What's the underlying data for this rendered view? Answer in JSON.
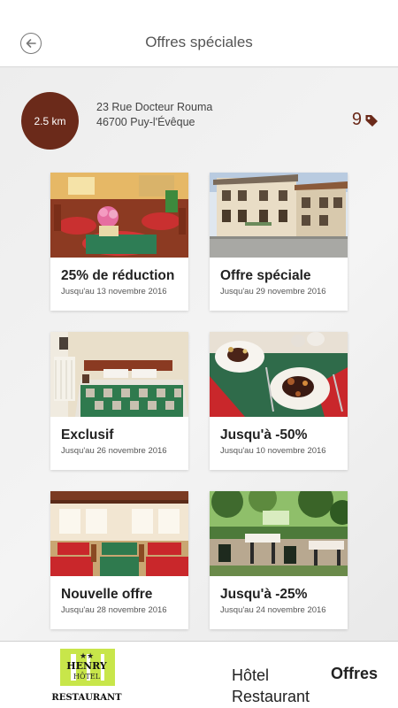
{
  "header": {
    "title": "Offres spéciales"
  },
  "location": {
    "distance": "2.5 km",
    "address_line1": "23 Rue Docteur Rouma",
    "address_line2": "46700 Puy-l'Évêque",
    "offer_count": "9"
  },
  "offers": [
    {
      "title": "25% de réduction",
      "date": "Jusqu'au 13 novembre 2016",
      "image": "restaurant-dining-room"
    },
    {
      "title": "Offre spéciale",
      "date": "Jusqu'au 29 novembre 2016",
      "image": "hotel-building"
    },
    {
      "title": "Exclusif",
      "date": "Jusqu'au 26 novembre 2016",
      "image": "hotel-bedroom"
    },
    {
      "title": "Jusqu'à -50%",
      "date": "Jusqu'au 10 novembre 2016",
      "image": "plated-dish"
    },
    {
      "title": "Nouvelle offre",
      "date": "Jusqu'au 28 novembre 2016",
      "image": "restaurant-hall"
    },
    {
      "title": "Jusqu'à -25%",
      "date": "Jusqu'au 24 novembre 2016",
      "image": "garden-terrace"
    }
  ],
  "bottom_nav": {
    "logo_top": "HENRY",
    "logo_mid": "HÔTEL",
    "logo_bottom": "RESTAURANT",
    "hotel_label": "Hôtel",
    "restaurant_label": "Restaurant",
    "offres_label": "Offres"
  },
  "colors": {
    "accent": "#6b2a1a",
    "logo_green": "#c8e64a"
  }
}
